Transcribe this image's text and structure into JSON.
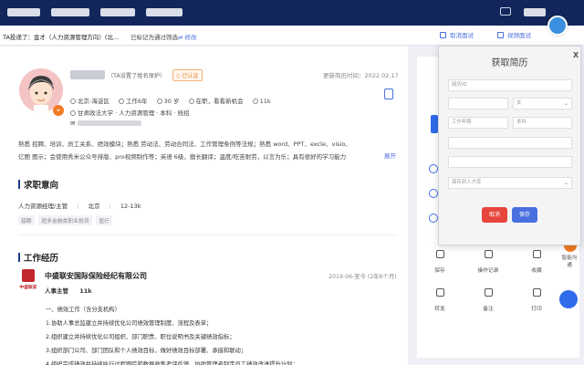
{
  "colors": {
    "topbar": "#12265b",
    "accent": "#4a6fe0",
    "cancel": "#e8453c",
    "save": "#4a6fe0",
    "orange": "#f27a22"
  },
  "subbar": {
    "title": "TA投递了：金才（人力资源管理方向）(北...",
    "status": "已标记为通过筛选",
    "edit": "⇄ 修改",
    "btn_interview": "取消面试",
    "btn_view": "视频面试"
  },
  "profile": {
    "name_tag": "（TA设置了姓名保护）",
    "verified": "◇ 已认证",
    "update_time": "更新简历时间：2022.02.17",
    "location": "北京-海淀区",
    "experience": "工作6年",
    "age": "30 岁",
    "status": "在职，看看新机会",
    "salary": "11k",
    "school": "甘肃政法大学 · 人力资源管理 · 本科 · 统招",
    "email_prefix": "✉"
  },
  "skills": {
    "line1": "熟悉 招聘、培训、员工关系、绩效模块；熟悉 劳动法、劳动合同法、工作管理条例等法规；熟悉 word、PPT、excle、visio、",
    "line2": "亿图 图示；会使用秀米公众号排版、pro视频制作等；英语 6级，擅长翻译；温度/吃苦耐劳，以言为乐；具有很好的学习能力",
    "expand": "展开"
  },
  "intention": {
    "title": "求职意向",
    "role": "人力资源经理/主管",
    "city": "北京",
    "salary": "12-13k",
    "tags": [
      "猎聘",
      "超多金融类职业投资",
      "医疗"
    ]
  },
  "work": {
    "title": "工作经历",
    "logo_text": "中盛联安",
    "company": "中盛联安国际保险经纪有限公司",
    "period": "2019.06-至今 (2年6个月)",
    "role": "人事主管",
    "salary": "11k",
    "duties": [
      "一、绩效工作（含分支机构）",
      "1.协助人事总监建立并持续优化公司绩效管理制度、流程及表单；",
      "2.组织建立并持续优化公司组织、部门职责、职位说明书及关键绩效指标；",
      "3.组织部门公司、部门团队和个人绩效目标，做好绩效目标部署、承接和联动；",
      "4.组织完成绩效并持续执行过程跟踪和数据收集考评反馈，协助管理者制定员工绩效改进提升计划；"
    ]
  },
  "rpanel": {
    "actions": [
      {
        "label": "保存",
        "icon": "save-icon"
      },
      {
        "label": "操作记录",
        "icon": "record-icon"
      },
      {
        "label": "收藏",
        "icon": "star-icon"
      },
      {
        "label": "转发",
        "icon": "forward-icon"
      },
      {
        "label": "备注",
        "icon": "note-icon"
      },
      {
        "label": "打印",
        "icon": "print-icon"
      }
    ],
    "side_tool": "智能沟通"
  },
  "modal": {
    "title": "获取简历",
    "close": "X",
    "fields": {
      "resume_id": "简历ID",
      "name": "",
      "gender": "女",
      "work_years": "工作年限",
      "degree": "本科",
      "field_a": "",
      "field_b": "",
      "target": "保存到人才库"
    },
    "cancel": "取消",
    "save": "保存"
  }
}
